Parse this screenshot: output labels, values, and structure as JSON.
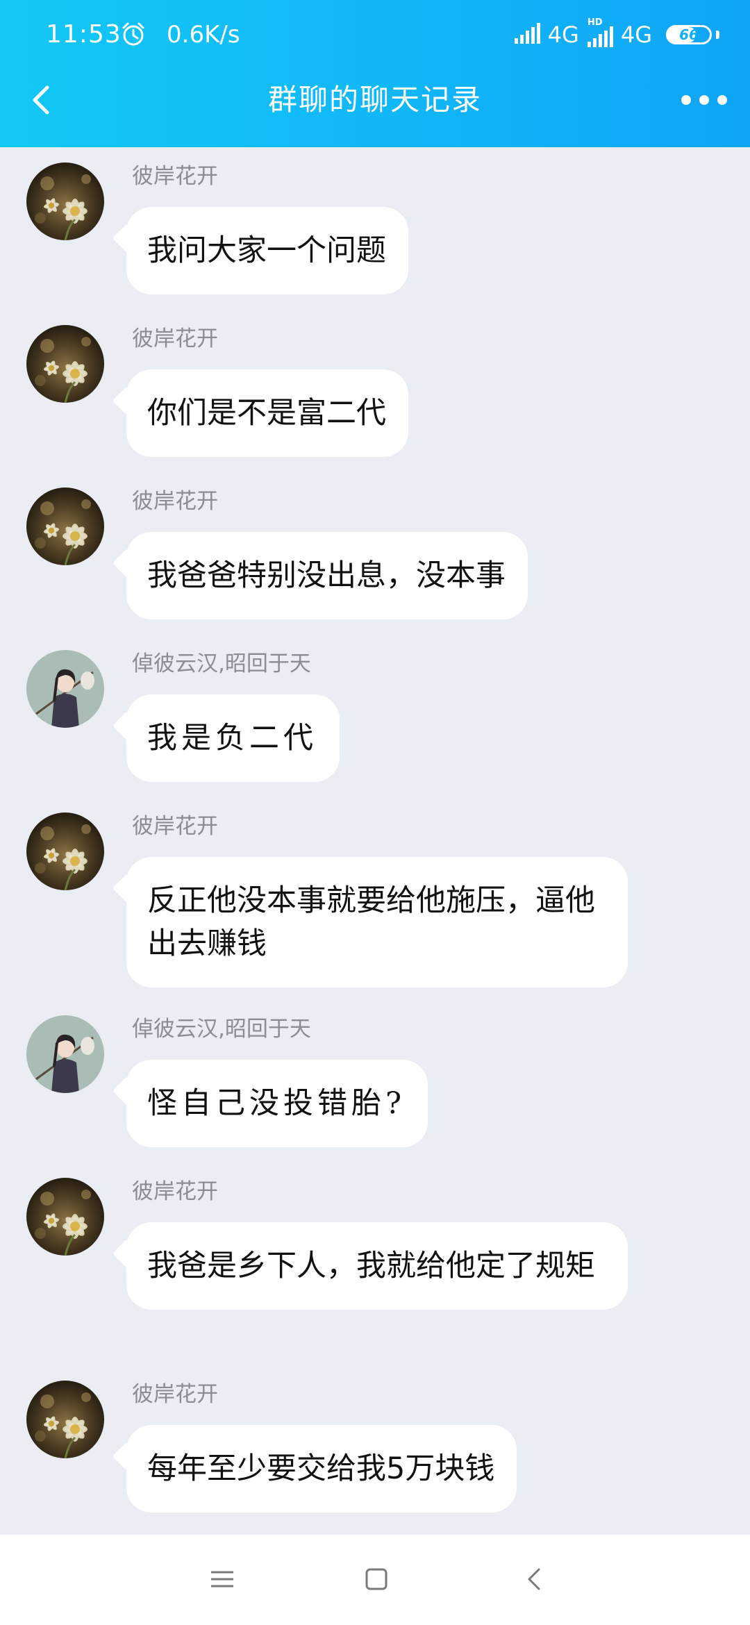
{
  "status_bar": {
    "time": "11:53",
    "net_speed": "0.6K/s",
    "network_1": "4G",
    "network_2": "4G",
    "hd_label": "HD",
    "battery_level": "66",
    "icons": [
      "alarm-icon",
      "signal-icon",
      "signal-hd-icon",
      "battery-icon"
    ]
  },
  "header": {
    "title": "群聊的聊天记录",
    "back_icon": "chevron-left-icon",
    "more_icon": "more-dots-icon"
  },
  "messages": [
    {
      "sender": "彼岸花开",
      "text": "我问大家一个问题"
    },
    {
      "sender": "彼岸花开",
      "text": "你们是不是富二代"
    },
    {
      "sender": "彼岸花开",
      "text": "我爸爸特别没出息，没本事"
    },
    {
      "sender": "倬彼云汉,昭回于天",
      "text": "我是负二代"
    },
    {
      "sender": "彼岸花开",
      "text": "反正他没本事就要给他施压，逼他出去赚钱"
    },
    {
      "sender": "倬彼云汉,昭回于天",
      "text": "怪自己没投错胎?"
    },
    {
      "sender": "彼岸花开",
      "text": "我爸是乡下人，我就给他定了规矩"
    },
    {
      "sender": "彼岸花开",
      "text": "每年至少要交给我5万块钱"
    }
  ],
  "nav_bar": {
    "icons": [
      "menu-icon",
      "home-square-icon",
      "back-triangle-icon"
    ]
  },
  "colors": {
    "header_gradient_start": "#13c8f6",
    "header_gradient_end": "#0fa4f6",
    "chat_background": "#ebedf5",
    "bubble": "#ffffff",
    "sender_text": "#8a8d95"
  }
}
